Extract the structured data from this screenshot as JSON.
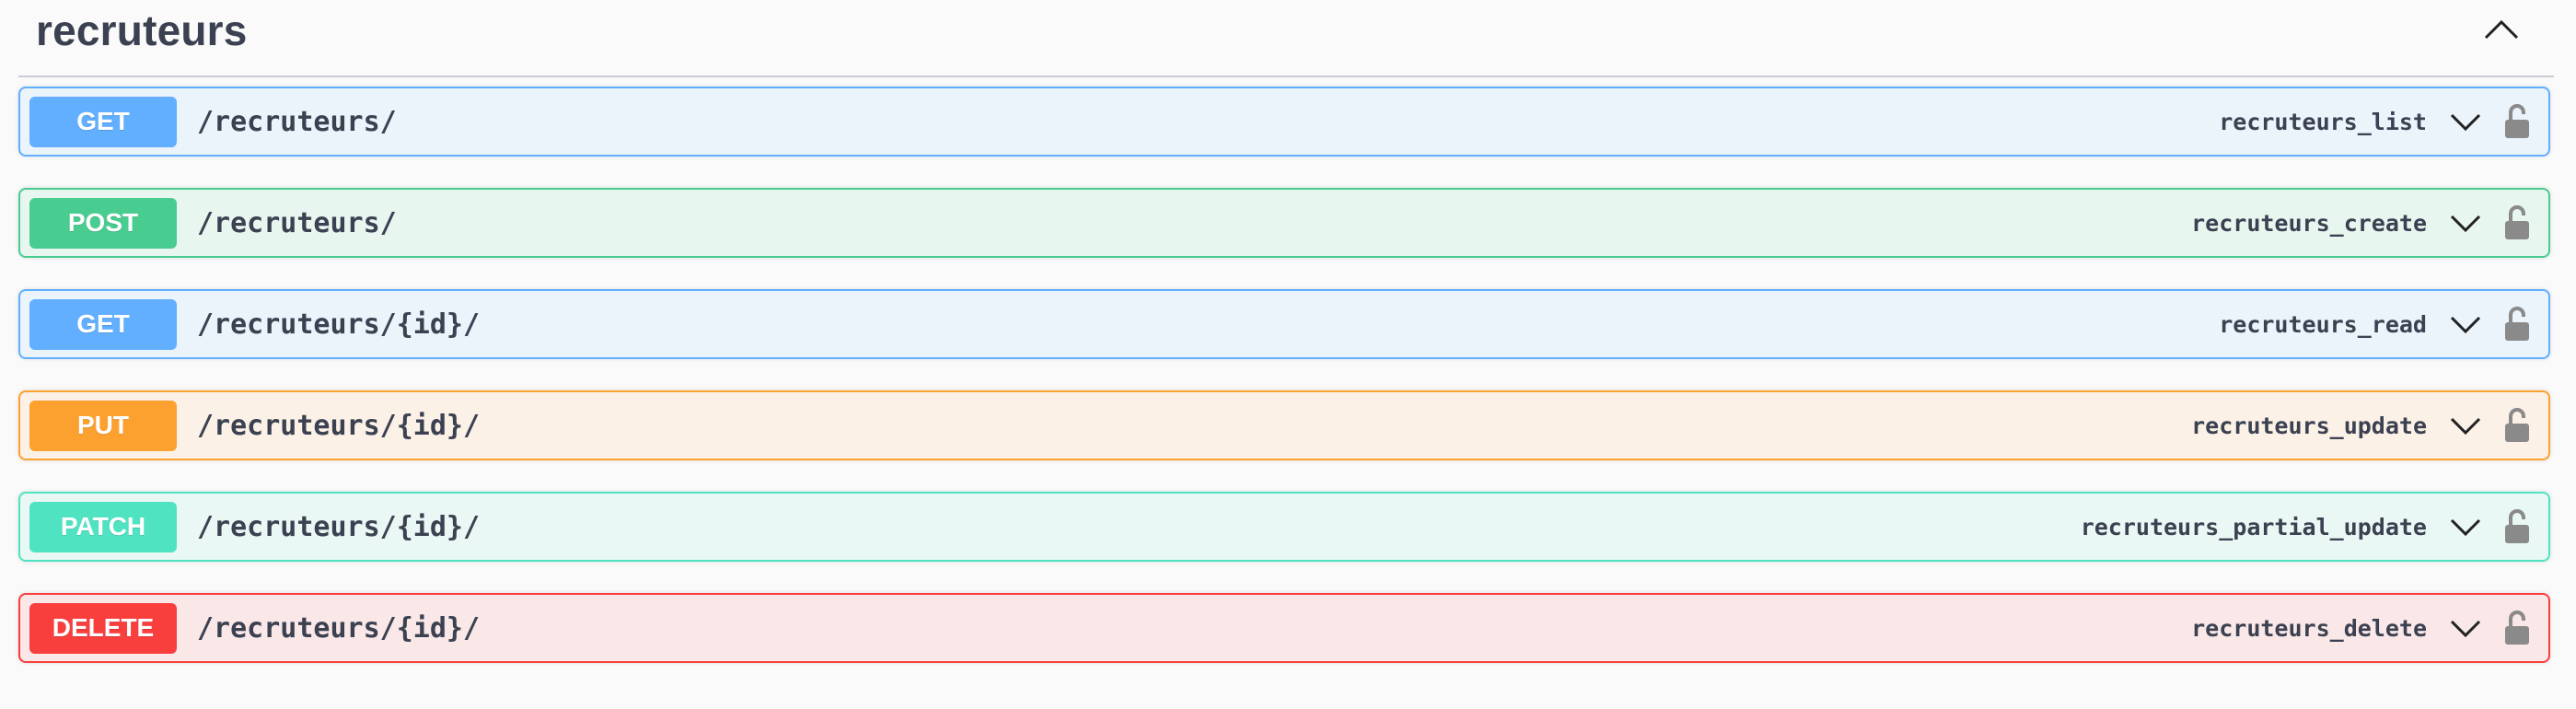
{
  "tag": {
    "title": "recruteurs"
  },
  "icons": {
    "collapse": "chevron-up-icon",
    "expand": "chevron-down-icon",
    "lock": "unlocked-icon"
  },
  "colors": {
    "get": "#61affe",
    "post": "#49cc90",
    "put": "#fca130",
    "patch": "#50e3c2",
    "delete": "#f93e3e"
  },
  "operations": [
    {
      "method": "GET",
      "path": "/recruteurs/",
      "operation_id": "recruteurs_list"
    },
    {
      "method": "POST",
      "path": "/recruteurs/",
      "operation_id": "recruteurs_create"
    },
    {
      "method": "GET",
      "path": "/recruteurs/{id}/",
      "operation_id": "recruteurs_read"
    },
    {
      "method": "PUT",
      "path": "/recruteurs/{id}/",
      "operation_id": "recruteurs_update"
    },
    {
      "method": "PATCH",
      "path": "/recruteurs/{id}/",
      "operation_id": "recruteurs_partial_update"
    },
    {
      "method": "DELETE",
      "path": "/recruteurs/{id}/",
      "operation_id": "recruteurs_delete"
    }
  ]
}
